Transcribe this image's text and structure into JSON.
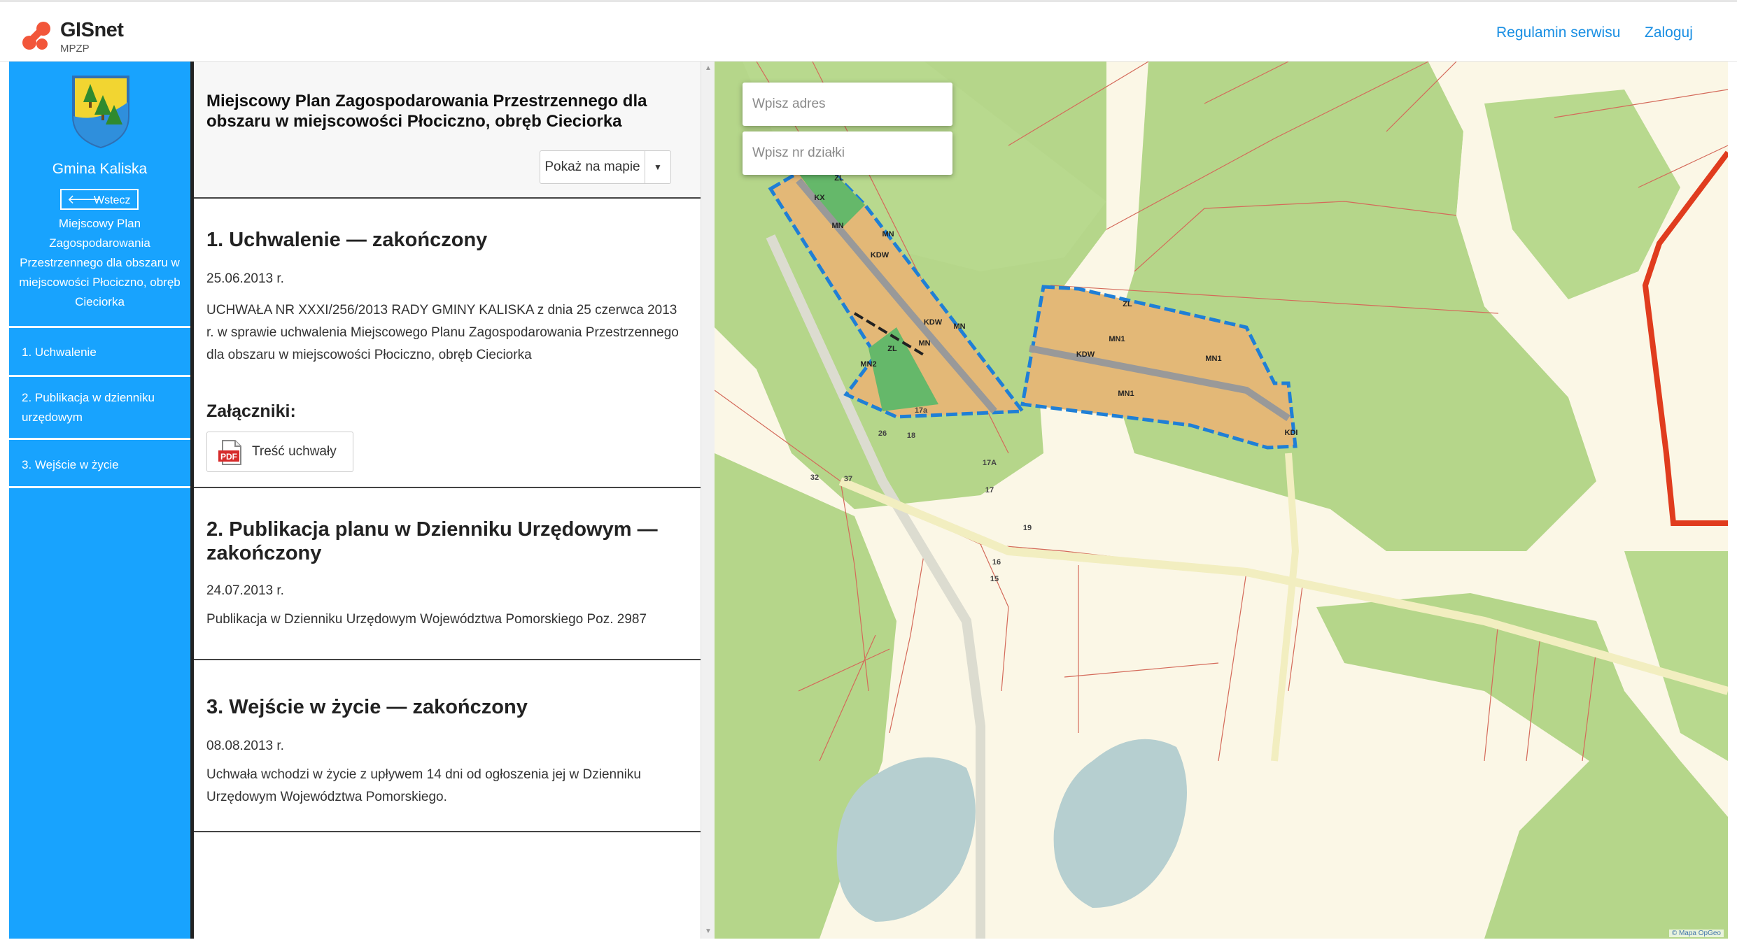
{
  "header": {
    "brand": "GISnet",
    "subtitle": "MPZP",
    "links": {
      "regulamin": "Regulamin serwisu",
      "login": "Zaloguj"
    }
  },
  "sidebar": {
    "gmina": "Gmina Kaliska",
    "back_label": "Wstecz",
    "plan_title": "Miejscowy Plan Zagospodarowania Przestrzennego dla obszaru w miejscowości Płociczno, obręb Cieciorka",
    "items": [
      {
        "label": "1. Uchwalenie"
      },
      {
        "label": "2. Publikacja w dzienniku urzędowym"
      },
      {
        "label": "3. Wejście w życie"
      }
    ]
  },
  "panel": {
    "title": "Miejscowy Plan Zagospodarowania Przestrzennego dla obszaru w miejscowości Płociczno, obręb Cieciorka",
    "show_on_map": "Pokaż na mapie",
    "sections": [
      {
        "title": "1. Uchwalenie — zakończony",
        "date": "25.06.2013 r.",
        "body": "UCHWAŁA NR XXXI/256/2013 RADY GMINY KALISKA z dnia 25 czerwca 2013 r. w sprawie uchwalenia Miejscowego Planu Zagospodarowania Przestrzennego dla obszaru w miejscowości Płociczno, obręb Cieciorka",
        "attachments_label": "Załączniki:",
        "attachment": "Treść uchwały"
      },
      {
        "title": "2. Publikacja planu w Dzienniku Urzędowym — zakończony",
        "date": "24.07.2013 r.",
        "body": "Publikacja w Dzienniku Urzędowym Województwa Pomorskiego Poz. 2987"
      },
      {
        "title": "3. Wejście w życie — zakończony",
        "date": "08.08.2013 r.",
        "body": "Uchwała wchodzi w życie z upływem 14 dni od ogłoszenia jej w Dzienniku Urzędowym Województwa Pomorskiego."
      }
    ]
  },
  "map": {
    "address_placeholder": "Wpisz adres",
    "parcel_placeholder": "Wpisz nr działki",
    "attribution": "© Mapa OpGeo",
    "zone_labels": {
      "kx": "KX",
      "zl_top": "ZL",
      "mn_a": "MN",
      "mn_b": "MN",
      "kdw_a": "KDW",
      "kdw_b": "KDW",
      "mn_c": "MN",
      "mn_d": "MN",
      "zl_mid": "ZL",
      "mn2": "MN2",
      "zl_right": "ZL",
      "mn1_a": "MN1",
      "kdw_c": "KDW",
      "mn1_b": "MN1",
      "mn1_c": "MN1",
      "kdi": "KDI"
    },
    "parcel_labels": {
      "p17a": "17a",
      "p26": "26",
      "p18": "18",
      "p17A": "17A",
      "p32": "32",
      "p37": "37",
      "p17": "17",
      "p19": "19",
      "p16": "16",
      "p15": "15"
    },
    "colors": {
      "forest": "#b5d68a",
      "residential": "#e3b877",
      "protected": "#65b86a",
      "boundary": "#1f7fd6",
      "gmina_border": "#e03c1e",
      "water": "#b6cfd0",
      "sidebar": "#18a3fe",
      "link": "#1a8fe3"
    }
  }
}
